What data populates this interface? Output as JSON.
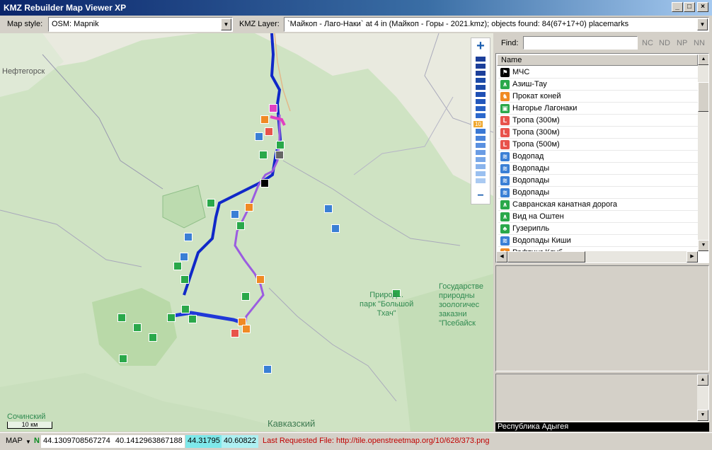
{
  "window": {
    "title": "KMZ Rebuilder Map Viewer XP",
    "buttons": [
      "_",
      "□",
      "×"
    ]
  },
  "toolbar": {
    "map_style_label": "Map style:",
    "map_style_value": "OSM: Mapnik",
    "kmz_layer_label": "KMZ Layer:",
    "kmz_layer_value": "`Майкоп - Лаго-Наки` at 4 in (Майкоп - Горы - 2021.kmz); objects found: 84(67+17+0) placemarks"
  },
  "map": {
    "labels": {
      "neftegorsk": "Нефтегорск",
      "sochi": "Сочинский",
      "kavkazsky": "Кавказский",
      "park": "Природ...\nпарк \"Большой\nТхач\"",
      "reserve": "Государстве\nприродны\nзоологичес\nзаказни\n\"Псебайск"
    },
    "zoom_level": "10",
    "scale_text": "10 км"
  },
  "find": {
    "label": "Find:",
    "value": "",
    "buttons": [
      "NC",
      "ND",
      "NP",
      "NN"
    ]
  },
  "list": {
    "column_name": "Name",
    "rows": [
      {
        "name": "МЧС",
        "icon": "flag-icon",
        "color": "#000000"
      },
      {
        "name": "Азиш-Тау",
        "icon": "cave-icon",
        "color": "#2aa84a"
      },
      {
        "name": "Прокат коней",
        "icon": "horse-icon",
        "color": "#f08a24"
      },
      {
        "name": "Нагорье Лагонаки",
        "icon": "photo-icon",
        "color": "#2aa84a"
      },
      {
        "name": "Тропа (300м)",
        "icon": "trail-icon",
        "color": "#e8534b"
      },
      {
        "name": "Тропа (300м)",
        "icon": "trail-icon",
        "color": "#e8534b"
      },
      {
        "name": "Тропа (500м)",
        "icon": "trail-icon",
        "color": "#e8534b"
      },
      {
        "name": "Водопад",
        "icon": "waterfall-icon",
        "color": "#3a7fd5"
      },
      {
        "name": "Водопады",
        "icon": "waterfall-icon",
        "color": "#3a7fd5"
      },
      {
        "name": "Водопады",
        "icon": "waterfall-icon",
        "color": "#3a7fd5"
      },
      {
        "name": "Водопады",
        "icon": "waterfall-icon",
        "color": "#3a7fd5"
      },
      {
        "name": "Савранская канатная дорога",
        "icon": "cave-icon",
        "color": "#2aa84a"
      },
      {
        "name": "Вид на Оштен",
        "icon": "cave-icon",
        "color": "#2aa84a"
      },
      {
        "name": "Гузерипль",
        "icon": "tree-icon",
        "color": "#2aa84a"
      },
      {
        "name": "Водопады Киши",
        "icon": "waterfall-icon",
        "color": "#3a7fd5"
      },
      {
        "name": "Рафтинг Клуб",
        "icon": "horse-icon",
        "color": "#f08a24"
      }
    ]
  },
  "region": "Республика Адыгея",
  "status": {
    "mode": "MAP",
    "north": "N",
    "lat1": "44.1309708567274",
    "lon1": "40.1412963867188",
    "lat2": "44.31795",
    "lon2": "40.60822",
    "last_request": "Last Requested File: http://tile.openstreetmap.org/10/628/373.png"
  }
}
